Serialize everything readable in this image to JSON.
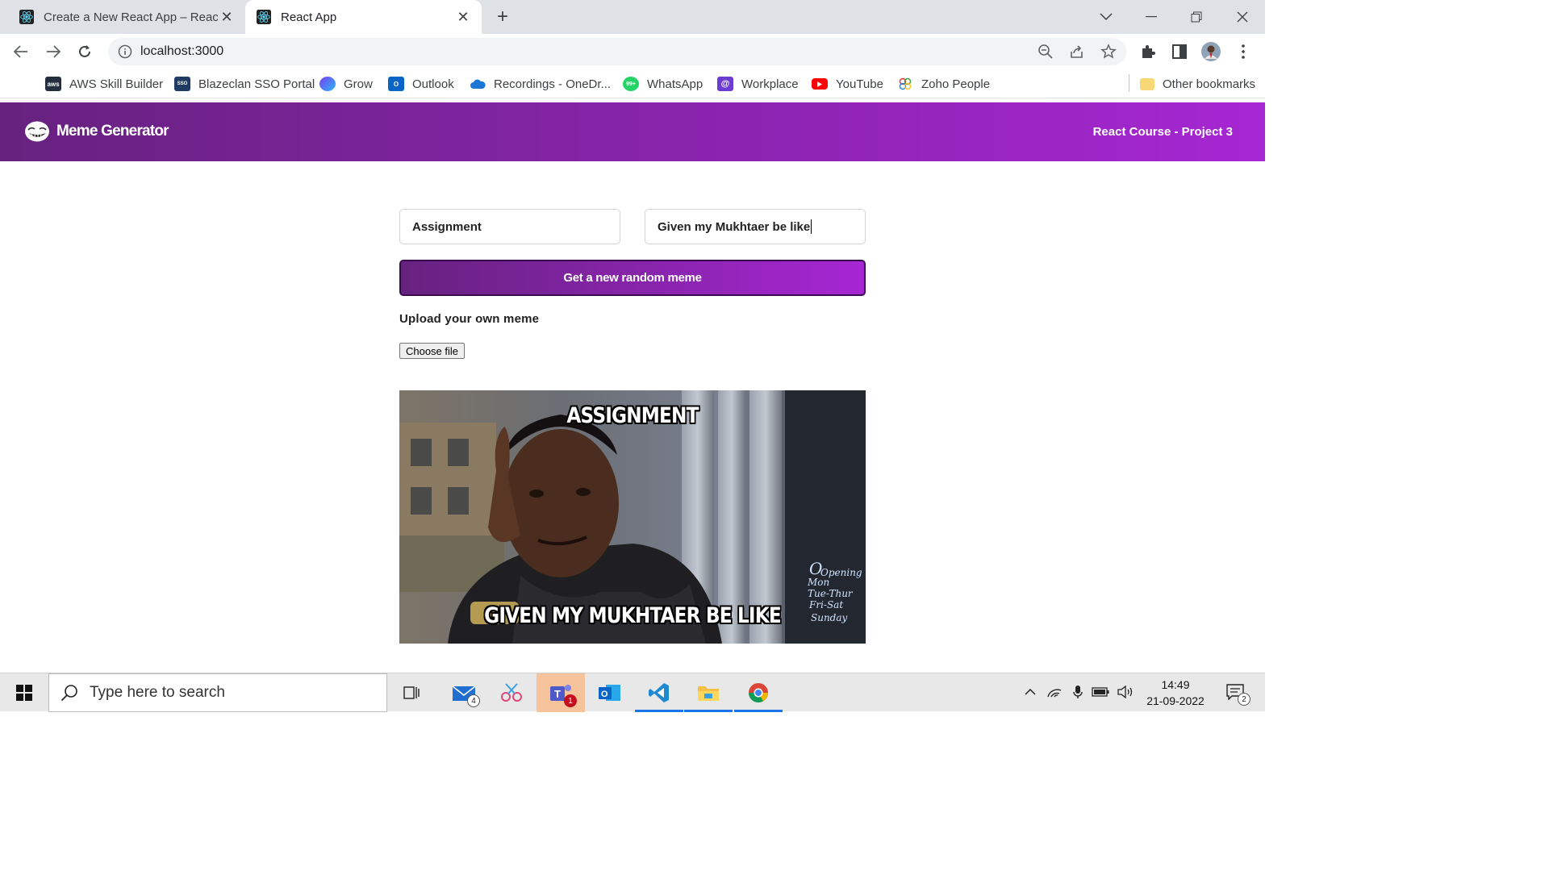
{
  "browser": {
    "tabs": [
      {
        "title": "Create a New React App – React"
      },
      {
        "title": "React App"
      }
    ],
    "url": "localhost:3000",
    "bookmarks": [
      {
        "label": "AWS Skill Builder"
      },
      {
        "label": "Blazeclan SSO Portal"
      },
      {
        "label": "Grow"
      },
      {
        "label": "Outlook"
      },
      {
        "label": "Recordings - OneDr..."
      },
      {
        "label": "WhatsApp"
      },
      {
        "label": "Workplace"
      },
      {
        "label": "YouTube"
      },
      {
        "label": "Zoho People"
      }
    ],
    "other_bookmarks": "Other bookmarks"
  },
  "app": {
    "title": "Meme Generator",
    "project": "React Course - Project 3",
    "top_text": "Assignment",
    "bottom_text": "Given my Mukhtaer be like",
    "button_label": "Get a new random meme",
    "upload_label": "Upload your own meme",
    "choose_file": "Choose file",
    "meme_top": "ASSIGNMENT",
    "meme_bottom": "GIVEN MY MUKHTAER BE LIKE",
    "meme_sign": [
      "Opening",
      "Mon",
      "Tue-Thur",
      "Fri-Sat",
      "Sunday"
    ]
  },
  "taskbar": {
    "search_placeholder": "Type here to search",
    "mail_badge": "4",
    "teams_badge": "1",
    "notif_badge": "2",
    "time": "14:49",
    "date": "21-09-2022"
  },
  "colors": {
    "header_gradient_start": "#672280",
    "header_gradient_end": "#a626d3"
  }
}
